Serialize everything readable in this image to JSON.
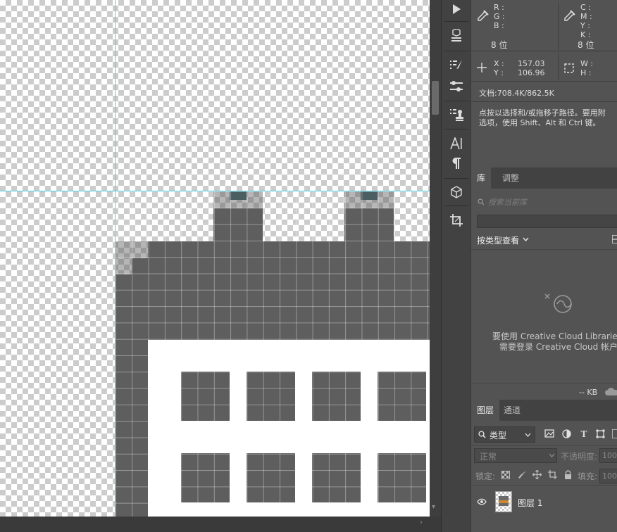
{
  "info_panel": {
    "color1": {
      "labels": [
        "R :",
        "G :",
        "B :"
      ],
      "bits": "8 位"
    },
    "color2": {
      "labels": [
        "C :",
        "M :",
        "Y :",
        "K :"
      ],
      "bits": "8 位"
    },
    "coords": {
      "x_label": "X :",
      "x_value": "157.03",
      "y_label": "Y :",
      "y_value": "106.96"
    },
    "size": {
      "w_label": "W :",
      "h_label": "H :"
    },
    "doc": "文档:708.4K/862.5K",
    "hint_line1": "点按以选择和/或拖移子路径。要用附",
    "hint_line2": "选项，使用 Shift、Alt 和 Ctrl 键。"
  },
  "libraries_panel": {
    "tabs": [
      "库",
      "调整"
    ],
    "search_placeholder": "搜索当前库",
    "view_by": "按类型查看",
    "message_line1": "要使用 Creative Cloud Libraries，",
    "message_line2": "需要登录 Creative Cloud 帐户。",
    "size": "-- KB"
  },
  "layers_panel": {
    "tabs": [
      "图层",
      "通道"
    ],
    "filter_label": "类型",
    "blend_mode": "正常",
    "opacity_label": "不透明度:",
    "opacity_value": "100",
    "lock_label": "锁定:",
    "fill_label": "填充:",
    "fill_value": "100",
    "layer_name": "图层 1"
  },
  "colors": {
    "canvas_bg": "#535353",
    "guide": "#4dd4e8",
    "pixel_fill": "#5e5e5e",
    "panel_bg": "#535353",
    "toolbar_bg": "#424242"
  }
}
